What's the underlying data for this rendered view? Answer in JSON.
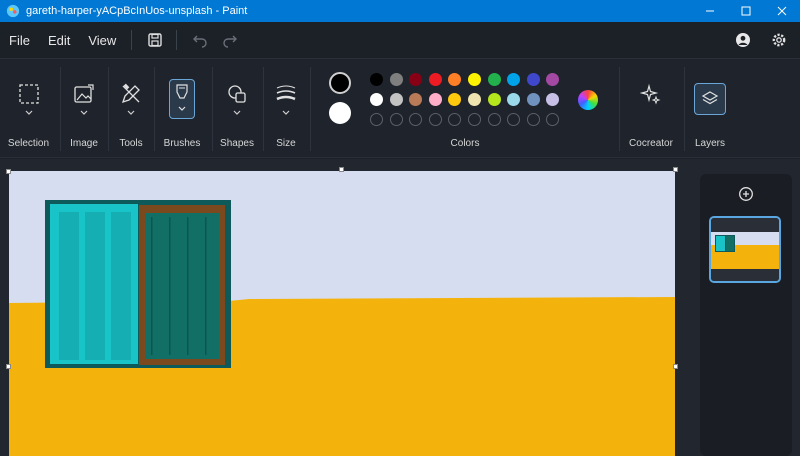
{
  "window": {
    "title": "gareth-harper-yACpBcInUos-unsplash - Paint",
    "controls": [
      "minimize",
      "maximize",
      "close"
    ]
  },
  "menu": {
    "file": "File",
    "edit": "Edit",
    "view": "View"
  },
  "ribbon": {
    "selection": "Selection",
    "image": "Image",
    "tools": "Tools",
    "brushes": "Brushes",
    "shapes": "Shapes",
    "size": "Size",
    "colors": "Colors",
    "cocreator": "Cocreator",
    "layers": "Layers"
  },
  "colors": {
    "primary": "#000000",
    "secondary": "#ffffff",
    "row1": [
      "#000000",
      "#7f7f7f",
      "#880015",
      "#ed1c24",
      "#ff7f27",
      "#fff200",
      "#22b14c",
      "#00a2e8",
      "#3f48cc",
      "#a349a4"
    ],
    "row2": [
      "#ffffff",
      "#c3c3c3",
      "#b97a57",
      "#ffaec9",
      "#ffc90e",
      "#efe4b0",
      "#b5e61d",
      "#99d9ea",
      "#7092be",
      "#c8bfe7"
    ]
  },
  "canvas": {
    "sky_color": "#d6ddf0",
    "wall_color": "#f4b30c",
    "window_frame_color": "#19c4c8",
    "window_door_color": "#116f66",
    "window_trim_color": "#7a4a1e"
  },
  "accent": "#0078d4"
}
